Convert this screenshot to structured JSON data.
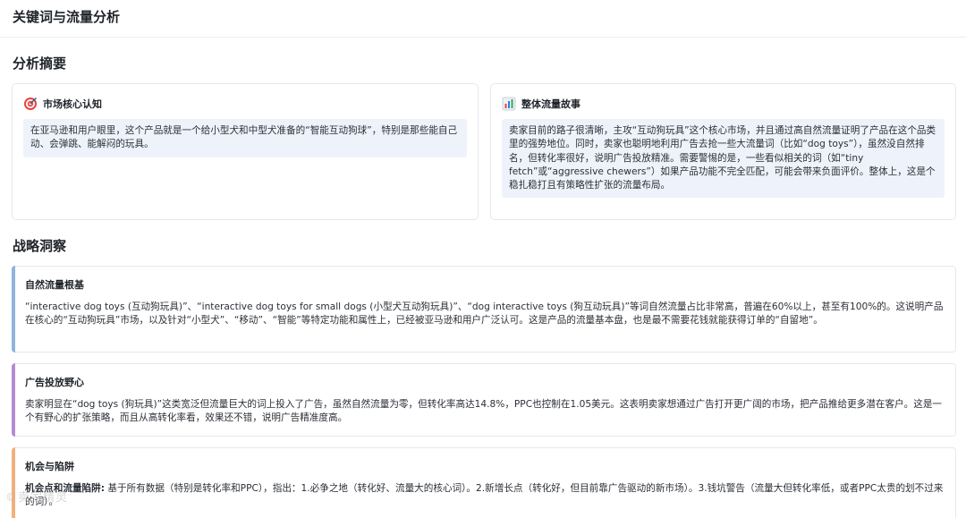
{
  "page": {
    "title": "关键词与流量分析"
  },
  "summary": {
    "title": "分析摘要",
    "cards": [
      {
        "icon": "target-icon",
        "title": "市场核心认知",
        "body": "在亚马逊和用户眼里，这个产品就是一个给小型犬和中型犬准备的“智能互动狗球”，特别是那些能自己动、会弹跳、能解闷的玩具。"
      },
      {
        "icon": "bar-chart-icon",
        "title": "整体流量故事",
        "body": "卖家目前的路子很清晰，主攻“互动狗玩具”这个核心市场，并且通过高自然流量证明了产品在这个品类里的强势地位。同时，卖家也聪明地利用广告去抢一些大流量词（比如“dog toys”），虽然没自然排名，但转化率很好，说明广告投放精准。需要警惕的是，一些看似相关的词（如“tiny fetch”或“aggressive chewers”）如果产品功能不完全匹配，可能会带来负面评价。整体上，这是个稳扎稳打且有策略性扩张的流量布局。"
      }
    ]
  },
  "strategy": {
    "title": "战略洞察",
    "items": [
      {
        "title": "自然流量根基",
        "body": "“interactive dog toys (互动狗玩具)”、“interactive dog toys for small dogs (小型犬互动狗玩具)”、“dog interactive toys (狗互动玩具)”等词自然流量占比非常高，普遍在60%以上，甚至有100%的。这说明产品在核心的“互动狗玩具”市场，以及针对“小型犬”、“移动”、“智能”等特定功能和属性上，已经被亚马逊和用户广泛认可。这是产品的流量基本盘，也是最不需要花钱就能获得订单的“自留地”。"
      },
      {
        "title": "广告投放野心",
        "body": "卖家明显在“dog toys (狗玩具)”这类宽泛但流量巨大的词上投入了广告，虽然自然流量为零，但转化率高达14.8%，PPC也控制在1.05美元。这表明卖家想通过广告打开更广阔的市场，把产品推给更多潜在客户。这是一个有野心的扩张策略，而且从高转化率看，效果还不错，说明广告精准度高。"
      },
      {
        "title": "机会与陷阱",
        "lead": "机会点和流量陷阱:",
        "body": "基于所有数据（特别是转化率和PPC），指出：1.必争之地（转化好、流量大的核心词）。2.新增长点（转化好，但目前靠广告驱动的新市场）。3.钱坑警告（流量大但转化率低，或者PPC太贵的划不过来的词）。"
      }
    ]
  },
  "watermark": "©卖家精灵"
}
